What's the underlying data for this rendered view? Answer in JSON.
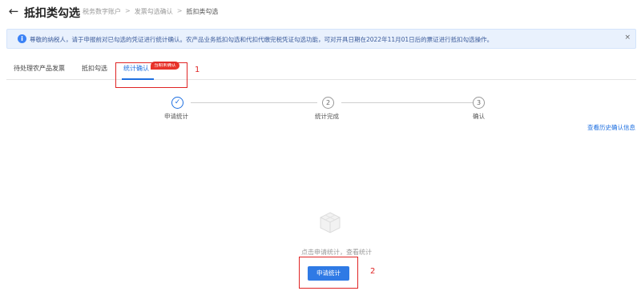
{
  "header": {
    "back_icon": "arrow-left-icon",
    "title": "抵扣类勾选",
    "breadcrumb": [
      "税务数字账户",
      "发票勾选确认",
      "抵扣类勾选"
    ],
    "separator": ">"
  },
  "notice": {
    "icon": "info-icon",
    "text": "尊敬的纳税人，请于申报前对已勾选的凭证进行统计确认。农产品业务抵扣勾选和代扣代缴完税凭证勾选功能，可对开具日期在2022年11月01日后的票证进行抵扣勾选操作。",
    "close_label": "×"
  },
  "tabs": [
    {
      "label": "待处理农产品发票",
      "active": false
    },
    {
      "label": "抵扣勾选",
      "active": false
    },
    {
      "label": "统计确认",
      "active": true,
      "badge": "当期未确认"
    }
  ],
  "steps": [
    {
      "index": "1",
      "label": "申请统计",
      "status": "done"
    },
    {
      "index": "2",
      "label": "统计完成",
      "status": "pending"
    },
    {
      "index": "3",
      "label": "确认",
      "status": "pending"
    }
  ],
  "history_link": "查看历史确认信息",
  "empty_state": {
    "icon": "empty-box-icon",
    "text": "点击申请统计，查看统计"
  },
  "primary_button": "申请统计",
  "annotations": [
    "1",
    "2"
  ],
  "colors": {
    "accent": "#1e6fe0",
    "badge": "#e8332a",
    "highlight": "#e02424",
    "notice_bg": "#e9f1fd"
  }
}
